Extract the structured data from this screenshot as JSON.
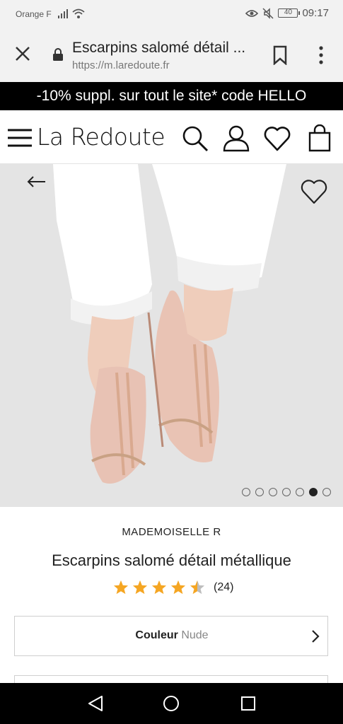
{
  "status": {
    "carrier": "Orange F",
    "battery": "40",
    "time": "09:17"
  },
  "browser": {
    "page_title": "Escarpins salomé détail ...",
    "url": "https://m.laredoute.fr"
  },
  "promo": {
    "text": "-10% suppl. sur tout le site* code HELLO"
  },
  "header": {
    "logo": "La Redoute"
  },
  "gallery": {
    "dots_total": 7,
    "active_index": 5
  },
  "product": {
    "brand": "MADEMOISELLE R",
    "title": "Escarpins salomé détail métallique",
    "rating": 4.5,
    "review_count": "(24)",
    "color_label": "Couleur",
    "color_value": "Nude"
  },
  "colors": {
    "star": "#f5a623",
    "promo_bg": "#000000"
  }
}
